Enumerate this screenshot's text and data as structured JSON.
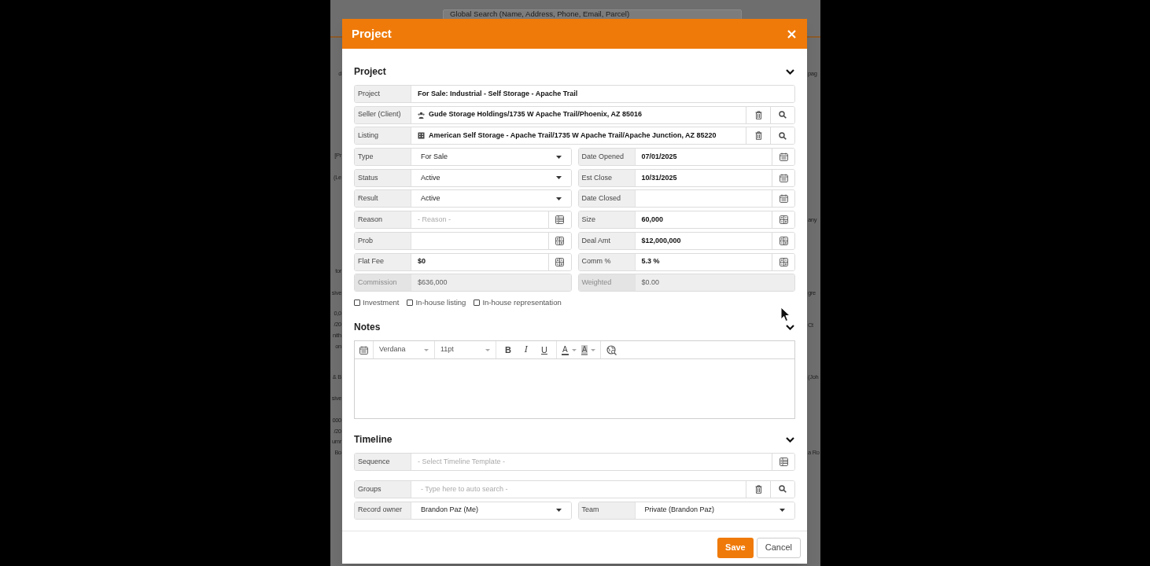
{
  "background": {
    "search": {
      "placeholder": "Global Search (Name, Address, Phone, Email, Parcel)"
    },
    "left_fragments": [
      "d",
      "[Pr",
      "(Le",
      "tor",
      "sive",
      "0,0",
      "/20",
      "nith",
      "on",
      "& B",
      "sive",
      "000",
      "/20",
      "umr",
      "Bo"
    ],
    "right_fragments": [
      "pag",
      "any",
      "gre",
      "Ct",
      "(Joh",
      "a Ro"
    ]
  },
  "dialog": {
    "title": "Project",
    "sections": [
      {
        "kind": "form",
        "title": "Project",
        "expanded": true,
        "rows": [
          {
            "fields": [
              {
                "label": "Project",
                "kind": "input",
                "value": "For Sale: Industrial - Self Storage - Apache Trail"
              }
            ]
          },
          {
            "fields": [
              {
                "label": "Seller (Client)",
                "kind": "lookup",
                "icon": {
                  "kind": "contact"
                },
                "value": "Gude Storage Holdings/1735 W Apache Trail/Phoenix, AZ 85016"
              }
            ]
          },
          {
            "fields": [
              {
                "label": "Listing",
                "kind": "lookup",
                "icon": {
                  "kind": "property"
                },
                "value": "American Self Storage - Apache Trail/1735 W Apache Trail/Apache Junction, AZ 85220"
              }
            ]
          },
          {
            "fields": [
              {
                "label": "Type",
                "kind": "select",
                "value": "For Sale"
              },
              {
                "label": "Date Opened",
                "kind": "input",
                "value": "07/01/2025",
                "button": {
                  "kind": "calendar"
                }
              }
            ]
          },
          {
            "fields": [
              {
                "label": "Status",
                "kind": "select",
                "value": "Active"
              },
              {
                "label": "Est Close",
                "kind": "input",
                "value": "10/31/2025",
                "button": {
                  "kind": "calendar"
                }
              }
            ]
          },
          {
            "fields": [
              {
                "label": "Result",
                "kind": "select",
                "value": "Active"
              },
              {
                "label": "Date Closed",
                "kind": "input",
                "button": {
                  "kind": "calendar"
                }
              }
            ]
          },
          {
            "fields": [
              {
                "label": "Reason",
                "kind": "input",
                "placeholder": "- Reason -",
                "button": {
                  "kind": "list"
                }
              },
              {
                "label": "Size",
                "kind": "input",
                "value": "60,000",
                "button": {
                  "kind": "calculator"
                }
              }
            ]
          },
          {
            "fields": [
              {
                "label": "Prob",
                "kind": "input",
                "button": {
                  "kind": "calculator"
                }
              },
              {
                "label": "Deal Amt",
                "kind": "input",
                "value": "$12,000,000",
                "button": {
                  "kind": "calculator"
                }
              }
            ]
          },
          {
            "fields": [
              {
                "label": "Flat Fee",
                "kind": "input",
                "value": "$0",
                "button": {
                  "kind": "calculator"
                }
              },
              {
                "label": "Comm %",
                "kind": "input",
                "value": "5.3 %",
                "button": {
                  "kind": "calculator"
                }
              }
            ]
          },
          {
            "fields": [
              {
                "label": "Commission",
                "kind": "readonly",
                "value": "$636,000"
              },
              {
                "label": "Weighted",
                "kind": "readonly",
                "value": "$0.00"
              }
            ]
          }
        ],
        "checkboxes": [
          {
            "label": "Investment",
            "checked": false
          },
          {
            "label": "In-house listing",
            "checked": false
          },
          {
            "label": "In-house representation",
            "checked": false
          }
        ]
      },
      {
        "kind": "editor",
        "title": "Notes",
        "expanded": true,
        "toolbar": {
          "font": "Verdana",
          "size": "11pt",
          "format_buttons": [
            {
              "kind": "bold",
              "label": "B"
            },
            {
              "kind": "italic",
              "label": "I"
            },
            {
              "kind": "underline",
              "label": "U"
            }
          ],
          "color_buttons": [
            {
              "kind": "text",
              "label": "A"
            },
            {
              "kind": "highlight",
              "label": "A"
            }
          ]
        }
      },
      {
        "kind": "form",
        "title": "Timeline",
        "expanded": true,
        "rows": [
          {
            "fields": [
              {
                "label": "Sequence",
                "kind": "input",
                "placeholder": "- Select Timeline Template -",
                "button": {
                  "kind": "list"
                }
              }
            ]
          },
          {
            "fields": [
              {
                "label": "Groups",
                "kind": "lookup",
                "placeholder": "- Type here to auto search -"
              }
            ]
          },
          {
            "fields": [
              {
                "label": "Record owner",
                "kind": "select",
                "value": "Brandon Paz (Me)"
              },
              {
                "label": "Team",
                "kind": "select",
                "value": "Private (Brandon Paz)"
              }
            ]
          }
        ]
      }
    ],
    "buttons": [
      {
        "label": "Save",
        "kind": "primary"
      },
      {
        "label": "Cancel",
        "kind": "secondary"
      }
    ]
  }
}
